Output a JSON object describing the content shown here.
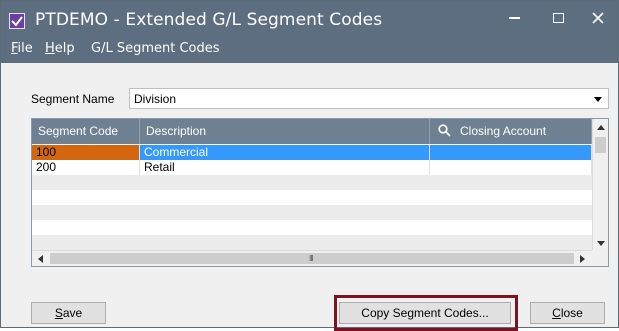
{
  "window": {
    "title": "PTDEMO - Extended G/L Segment Codes",
    "controls": {
      "minimize": "–",
      "maximize": "□",
      "close": "✕"
    },
    "icon": "checkmark-app-icon"
  },
  "menu": {
    "file_first": "F",
    "file_rest": "ile",
    "help_first": "H",
    "help_rest": "elp",
    "gl_segment_codes": "G/L Segment Codes"
  },
  "segment": {
    "label": "Segment Name",
    "selected": "Division"
  },
  "grid": {
    "headers": {
      "code": "Segment Code",
      "description": "Description",
      "closing_account": "Closing Account"
    },
    "rows": [
      {
        "code": "100",
        "description": "Commercial",
        "closing_account": ""
      },
      {
        "code": "200",
        "description": "Retail",
        "closing_account": ""
      }
    ],
    "scroll_grip": "III"
  },
  "buttons": {
    "save_first": "S",
    "save_rest": "ave",
    "copy": "Copy Segment Codes...",
    "close_first": "C",
    "close_rest": "lose"
  },
  "colors": {
    "titlebar": "#5d6e80",
    "header": "#6e8092",
    "selection": "#3399ff",
    "selected_code_cell": "#d4660f",
    "highlight_frame": "#7a1420"
  }
}
